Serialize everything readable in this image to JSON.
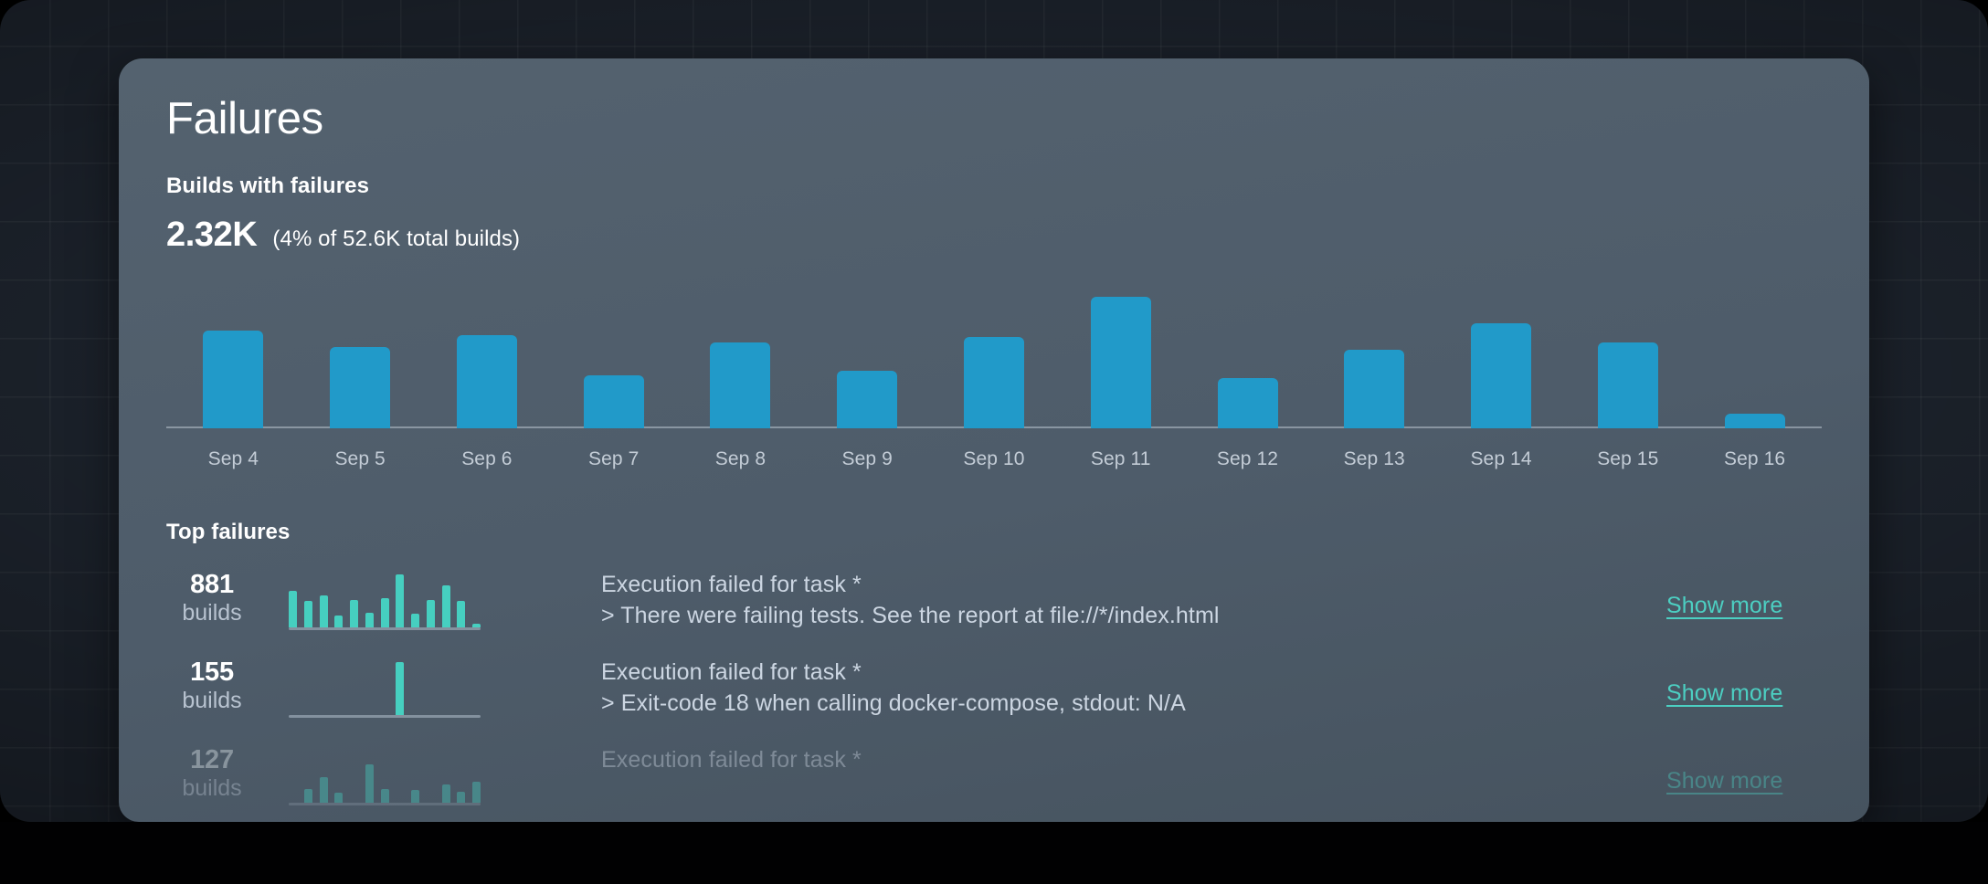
{
  "card": {
    "title": "Failures",
    "subhead": "Builds with failures",
    "metric_value": "2.32K",
    "metric_note": "(4% of 52.6K total builds)",
    "top_failures_title": "Top failures"
  },
  "colors": {
    "bar_blue": "#219ac9",
    "spark_green": "#46cfc0",
    "link_teal": "#4ccfc2",
    "card_bg": "#4e5c6a",
    "page_bg": "#1b212a"
  },
  "chart_data": {
    "type": "bar",
    "title": "Builds with failures",
    "xlabel": "",
    "ylabel": "Builds with failures",
    "grid": false,
    "legend": "none",
    "ylim": [
      0,
      275
    ],
    "categories": [
      "Sep 4",
      "Sep 5",
      "Sep 6",
      "Sep 7",
      "Sep 8",
      "Sep 9",
      "Sep 10",
      "Sep 11",
      "Sep 12",
      "Sep 13",
      "Sep 14",
      "Sep 15",
      "Sep 16"
    ],
    "values": [
      205,
      170,
      195,
      110,
      180,
      120,
      190,
      275,
      105,
      165,
      220,
      180,
      30
    ]
  },
  "failures": [
    {
      "count": "881",
      "unit": "builds",
      "message_line1": "Execution failed for task *",
      "message_line2": "> There were failing tests.  See the report at file://*/index.html",
      "action_label": "Show more",
      "sparkline": [
        68,
        50,
        60,
        23,
        52,
        28,
        55,
        100,
        25,
        52,
        80,
        50,
        6
      ]
    },
    {
      "count": "155",
      "unit": "builds",
      "message_line1": "Execution failed for task *",
      "message_line2": "> Exit-code 18 when calling docker-compose, stdout: N/A",
      "action_label": "Show more",
      "sparkline": [
        0,
        0,
        0,
        0,
        0,
        0,
        0,
        100,
        0,
        0,
        0,
        0,
        0
      ]
    },
    {
      "count": "127",
      "unit": "builds",
      "message_line1": "Execution failed for task *",
      "message_line2": "",
      "action_label": "Show more",
      "sparkline": [
        0,
        26,
        48,
        18,
        0,
        72,
        25,
        0,
        24,
        0,
        34,
        20,
        40
      ]
    }
  ]
}
